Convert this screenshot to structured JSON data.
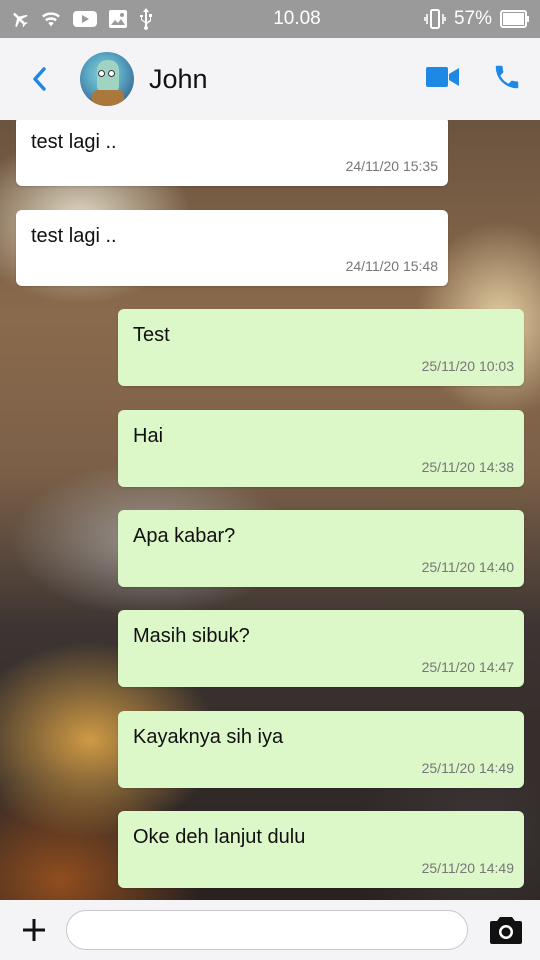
{
  "status_bar": {
    "time": "10.08",
    "battery_percent": "57%",
    "icons_left": [
      "airplane-icon",
      "wifi-icon",
      "youtube-icon",
      "gallery-icon",
      "usb-icon"
    ],
    "icons_right": [
      "vibrate-icon",
      "battery-icon"
    ]
  },
  "header": {
    "contact_name": "John",
    "accent_color": "#1e88e5"
  },
  "messages": [
    {
      "direction": "incoming",
      "text": "test lagi ..",
      "time": "24/11/20 15:35"
    },
    {
      "direction": "incoming",
      "text": "test lagi ..",
      "time": "24/11/20 15:48"
    },
    {
      "direction": "outgoing",
      "text": "Test",
      "time": "25/11/20 10:03"
    },
    {
      "direction": "outgoing",
      "text": "Hai",
      "time": "25/11/20 14:38"
    },
    {
      "direction": "outgoing",
      "text": "Apa kabar?",
      "time": "25/11/20 14:40"
    },
    {
      "direction": "outgoing",
      "text": "Masih sibuk?",
      "time": "25/11/20 14:47"
    },
    {
      "direction": "outgoing",
      "text": "Kayaknya sih iya",
      "time": "25/11/20 14:49"
    },
    {
      "direction": "outgoing",
      "text": "Oke deh lanjut dulu",
      "time": "25/11/20 14:49"
    }
  ],
  "input_bar": {
    "message_value": "",
    "placeholder": ""
  }
}
